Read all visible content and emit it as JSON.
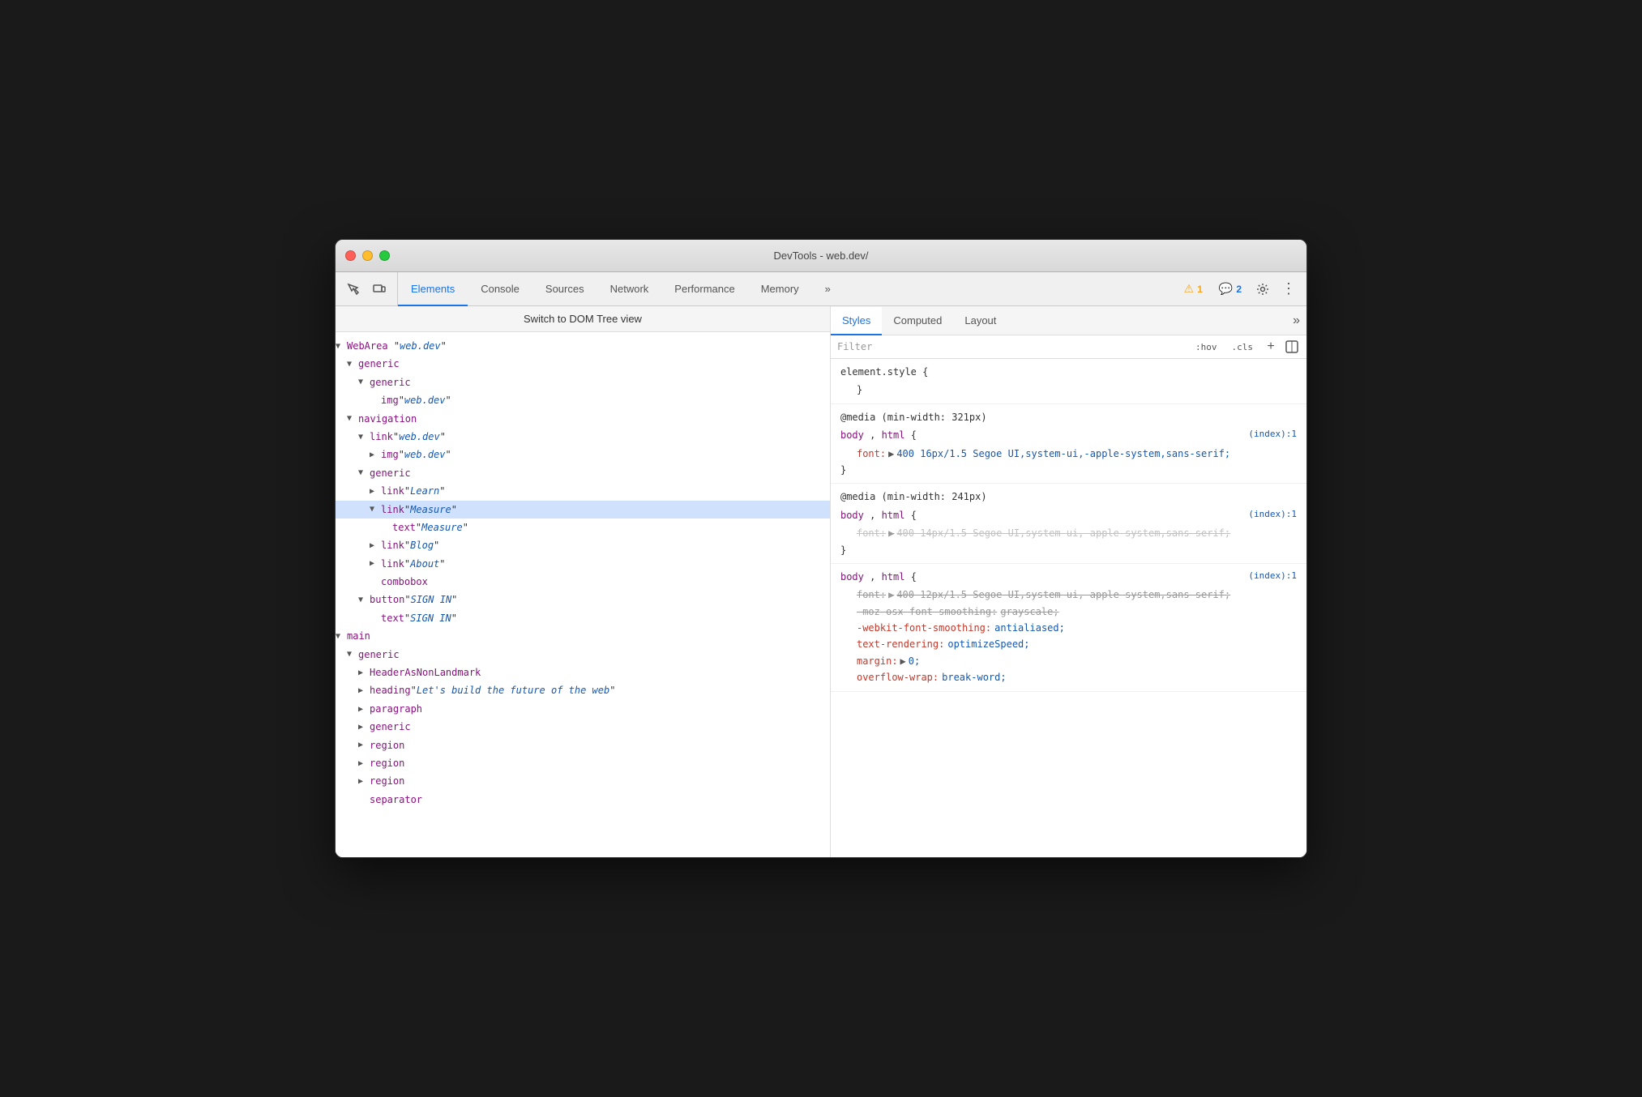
{
  "window": {
    "title": "DevTools - web.dev/"
  },
  "toolbar": {
    "tabs": [
      {
        "id": "elements",
        "label": "Elements",
        "active": true
      },
      {
        "id": "console",
        "label": "Console",
        "active": false
      },
      {
        "id": "sources",
        "label": "Sources",
        "active": false
      },
      {
        "id": "network",
        "label": "Network",
        "active": false
      },
      {
        "id": "performance",
        "label": "Performance",
        "active": false
      },
      {
        "id": "memory",
        "label": "Memory",
        "active": false
      },
      {
        "id": "more",
        "label": "»",
        "active": false
      }
    ],
    "warning_count": "1",
    "message_count": "2"
  },
  "dom_panel": {
    "switch_btn": "Switch to DOM Tree view",
    "tree": [
      {
        "id": 1,
        "depth": 0,
        "arrow": "down",
        "role": "WebArea",
        "name": "web.dev",
        "italic": true
      },
      {
        "id": 2,
        "depth": 1,
        "arrow": "down",
        "role": "generic",
        "name": "",
        "italic": false
      },
      {
        "id": 3,
        "depth": 2,
        "arrow": "down",
        "role": "generic",
        "name": "",
        "italic": false
      },
      {
        "id": 4,
        "depth": 3,
        "arrow": "none",
        "role": "img",
        "name": "web.dev",
        "italic": true
      },
      {
        "id": 5,
        "depth": 1,
        "arrow": "down",
        "role": "navigation",
        "name": "",
        "italic": false
      },
      {
        "id": 6,
        "depth": 2,
        "arrow": "down",
        "role": "link",
        "name": "web.dev",
        "italic": true
      },
      {
        "id": 7,
        "depth": 3,
        "arrow": "right",
        "role": "img",
        "name": "web.dev",
        "italic": true
      },
      {
        "id": 8,
        "depth": 2,
        "arrow": "down",
        "role": "generic",
        "name": "",
        "italic": false
      },
      {
        "id": 9,
        "depth": 3,
        "arrow": "right",
        "role": "link",
        "name": "Learn",
        "italic": true
      },
      {
        "id": 10,
        "depth": 3,
        "arrow": "down",
        "role": "link",
        "name": "Measure",
        "italic": true,
        "selected": true
      },
      {
        "id": 11,
        "depth": 4,
        "arrow": "none",
        "role": "text",
        "name": "Measure",
        "italic": true
      },
      {
        "id": 12,
        "depth": 3,
        "arrow": "right",
        "role": "link",
        "name": "Blog",
        "italic": true
      },
      {
        "id": 13,
        "depth": 3,
        "arrow": "right",
        "role": "link",
        "name": "About",
        "italic": true
      },
      {
        "id": 14,
        "depth": 3,
        "arrow": "none",
        "role": "combobox",
        "name": "",
        "italic": false
      },
      {
        "id": 15,
        "depth": 2,
        "arrow": "down",
        "role": "button",
        "name": "SIGN IN",
        "italic": true
      },
      {
        "id": 16,
        "depth": 3,
        "arrow": "none",
        "role": "text",
        "name": "SIGN IN",
        "italic": true
      },
      {
        "id": 17,
        "depth": 0,
        "arrow": "down",
        "role": "main",
        "name": "",
        "italic": false
      },
      {
        "id": 18,
        "depth": 1,
        "arrow": "down",
        "role": "generic",
        "name": "",
        "italic": false
      },
      {
        "id": 19,
        "depth": 2,
        "arrow": "right",
        "role": "HeaderAsNonLandmark",
        "name": "",
        "italic": false
      },
      {
        "id": 20,
        "depth": 2,
        "arrow": "right",
        "role": "heading",
        "name": "Let's build the future of the web",
        "italic": true
      },
      {
        "id": 21,
        "depth": 2,
        "arrow": "right",
        "role": "paragraph",
        "name": "",
        "italic": false
      },
      {
        "id": 22,
        "depth": 2,
        "arrow": "right",
        "role": "generic",
        "name": "",
        "italic": false
      },
      {
        "id": 23,
        "depth": 2,
        "arrow": "right",
        "role": "region",
        "name": "",
        "italic": false
      },
      {
        "id": 24,
        "depth": 2,
        "arrow": "right",
        "role": "region",
        "name": "",
        "italic": false
      },
      {
        "id": 25,
        "depth": 2,
        "arrow": "right",
        "role": "region",
        "name": "",
        "italic": false
      },
      {
        "id": 26,
        "depth": 2,
        "arrow": "none",
        "role": "separator",
        "name": "",
        "italic": false
      }
    ]
  },
  "styles_panel": {
    "tabs": [
      {
        "id": "styles",
        "label": "Styles",
        "active": true
      },
      {
        "id": "computed",
        "label": "Computed",
        "active": false
      },
      {
        "id": "layout",
        "label": "Layout",
        "active": false
      }
    ],
    "filter_placeholder": "Filter",
    "hov_btn": ":hov",
    "cls_btn": ".cls",
    "rules": [
      {
        "type": "element_style",
        "selector": "element.style {",
        "close": "}",
        "props": []
      },
      {
        "type": "media",
        "media": "@media (min-width: 321px)",
        "selector": "body, html {",
        "source": "(index):1",
        "close": "}",
        "props": [
          {
            "name": "font:",
            "arrow": true,
            "value": "400 16px/1.5 Segoe UI,system-ui,-apple-system,sans-serif;",
            "strikethrough": false
          }
        ]
      },
      {
        "type": "media",
        "media": "@media (min-width: 241px)",
        "selector": "body, html {",
        "source": "(index):1",
        "close": "}",
        "props": [
          {
            "name": "font:",
            "arrow": true,
            "value": "400 14px/1.5 Segoe UI,system-ui,-apple-system,sans-serif;",
            "strikethrough": true
          }
        ]
      },
      {
        "type": "rule",
        "selector": "body, html {",
        "source": "(index):1",
        "close": "}",
        "props": [
          {
            "name": "font:",
            "arrow": true,
            "value": "400 12px/1.5 Segoe UI,system-ui,-apple-system,sans-serif;",
            "strikethrough": true
          },
          {
            "name": "-moz-osx-font-smoothing:",
            "value": "grayscale;",
            "strikethrough": true
          },
          {
            "name": "-webkit-font-smoothing:",
            "value": "antialiased;",
            "strikethrough": false,
            "red_name": true
          },
          {
            "name": "text-rendering:",
            "value": "optimizeSpeed;",
            "strikethrough": false,
            "red_name": true
          },
          {
            "name": "margin:",
            "arrow": true,
            "value": "0;",
            "strikethrough": false,
            "red_name": true
          },
          {
            "name": "overflow-wrap:",
            "value": "break-word;",
            "strikethrough": false,
            "partial": true,
            "red_name": true
          }
        ]
      }
    ]
  }
}
